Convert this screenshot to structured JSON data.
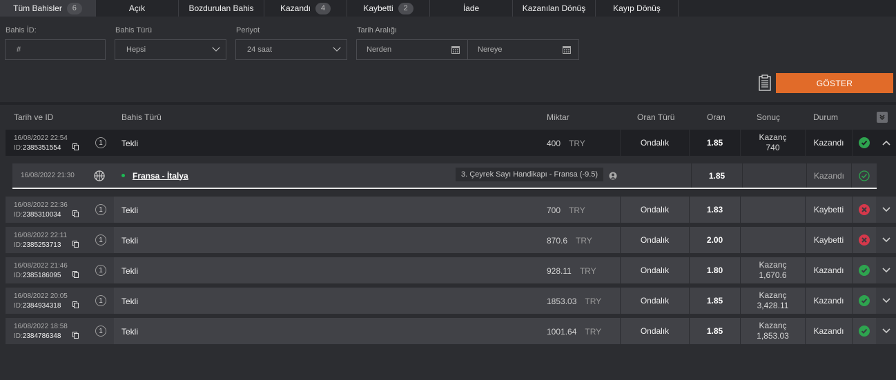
{
  "tabs": [
    {
      "label": "Tüm Bahisler",
      "count": "6"
    },
    {
      "label": "Açık",
      "count": ""
    },
    {
      "label": "Bozdurulan Bahis",
      "count": ""
    },
    {
      "label": "Kazandı",
      "count": "4"
    },
    {
      "label": "Kaybetti",
      "count": "2"
    },
    {
      "label": "İade",
      "count": ""
    },
    {
      "label": "Kazanılan Dönüş",
      "count": ""
    },
    {
      "label": "Kayıp Dönüş",
      "count": ""
    }
  ],
  "filters": {
    "bet_id_label": "Bahis İD:",
    "bet_id_placeholder": "#",
    "bet_type_label": "Bahis Türü",
    "bet_type_value": "Hepsi",
    "period_label": "Periyot",
    "period_value": "24 saat",
    "date_range_label": "Tarih Aralığı",
    "from_placeholder": "Nerden",
    "to_placeholder": "Nereye",
    "show_button": "GÖSTER"
  },
  "columns": {
    "date_id": "Tarih ve ID",
    "bet_type": "Bahis Türü",
    "amount": "Miktar",
    "odds_type": "Oran Türü",
    "odds": "Oran",
    "result": "Sonuç",
    "status": "Durum"
  },
  "colors": {
    "accent": "#e16b29",
    "win": "#2ea44f",
    "loss": "#d6384b"
  },
  "rows": [
    {
      "date": "16/08/2022 22:54",
      "id_prefix": "ID:",
      "id": "2385351554",
      "num": "1",
      "type": "Tekli",
      "amount": "400",
      "currency": "TRY",
      "odds_type": "Ondalık",
      "odds": "1.85",
      "result_label": "Kazanç",
      "result_value": "740",
      "status": "Kazandı",
      "status_icon": "check-icon"
    },
    {
      "date": "16/08/2022 22:36",
      "id_prefix": "ID:",
      "id": "2385310034",
      "num": "1",
      "type": "Tekli",
      "amount": "700",
      "currency": "TRY",
      "odds_type": "Ondalık",
      "odds": "1.83",
      "result_label": "",
      "result_value": "",
      "status": "Kaybetti",
      "status_icon": "cross-icon"
    },
    {
      "date": "16/08/2022 22:11",
      "id_prefix": "ID:",
      "id": "2385253713",
      "num": "1",
      "type": "Tekli",
      "amount": "870.6",
      "currency": "TRY",
      "odds_type": "Ondalık",
      "odds": "2.00",
      "result_label": "",
      "result_value": "",
      "status": "Kaybetti",
      "status_icon": "cross-icon"
    },
    {
      "date": "16/08/2022 21:46",
      "id_prefix": "ID:",
      "id": "2385186095",
      "num": "1",
      "type": "Tekli",
      "amount": "928.11",
      "currency": "TRY",
      "odds_type": "Ondalık",
      "odds": "1.80",
      "result_label": "Kazanç",
      "result_value": "1,670.6",
      "status": "Kazandı",
      "status_icon": "check-icon"
    },
    {
      "date": "16/08/2022 20:05",
      "id_prefix": "ID:",
      "id": "2384934318",
      "num": "1",
      "type": "Tekli",
      "amount": "1853.03",
      "currency": "TRY",
      "odds_type": "Ondalık",
      "odds": "1.85",
      "result_label": "Kazanç",
      "result_value": "3,428.11",
      "status": "Kazandı",
      "status_icon": "check-icon"
    },
    {
      "date": "16/08/2022 18:58",
      "id_prefix": "ID:",
      "id": "2384786348",
      "num": "1",
      "type": "Tekli",
      "amount": "1001.64",
      "currency": "TRY",
      "odds_type": "Ondalık",
      "odds": "1.85",
      "result_label": "Kazanç",
      "result_value": "1,853.03",
      "status": "Kazandı",
      "status_icon": "check-icon"
    }
  ],
  "detail": {
    "date": "16/08/2022 21:30",
    "sport_icon": "basketball-icon",
    "match": "Fransa - İtalya",
    "market": "3. Çeyrek Sayı Handikapı - Fransa (-9.5)",
    "odds": "1.85",
    "status": "Kazandı"
  }
}
